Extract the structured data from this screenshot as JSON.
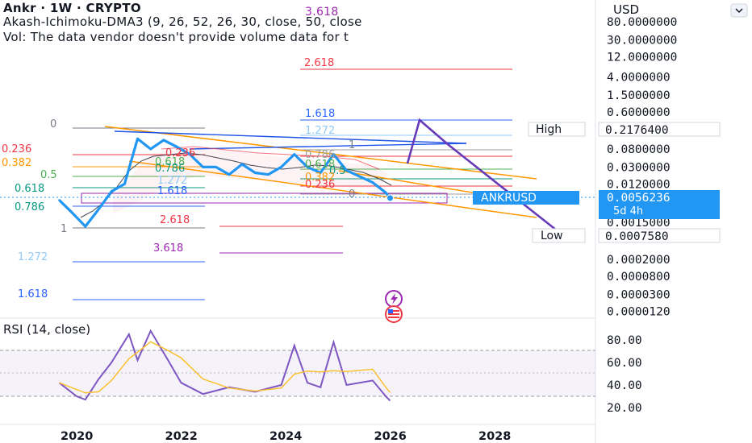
{
  "header": {
    "line1": "Ankr · 1W · CRYPTO",
    "line2": "Akash-Ichimoku-DMA3 (9, 26, 52, 26, 30, close, 50, close",
    "line3": "Vol: The data vendor doesn't provide volume data for t",
    "overlay_number": "3.618"
  },
  "currency": "USD",
  "collapse_icon": "chevron-collapse-icon",
  "price_axis": {
    "scale": "log",
    "ticks": [
      {
        "label": "80.0000000",
        "value": 80
      },
      {
        "label": "30.0000000",
        "value": 30
      },
      {
        "label": "12.0000000",
        "value": 12
      },
      {
        "label": "4.0000000",
        "value": 4
      },
      {
        "label": "1.5000000",
        "value": 1.5
      },
      {
        "label": "0.6000000",
        "value": 0.6
      },
      {
        "label": "0.0800000",
        "value": 0.08
      },
      {
        "label": "0.0300000",
        "value": 0.03
      },
      {
        "label": "0.0120000",
        "value": 0.012
      },
      {
        "label": "0.0015000",
        "value": 0.0015
      },
      {
        "label": "0.0002000",
        "value": 0.0002
      },
      {
        "label": "0.0000800",
        "value": 8e-05
      },
      {
        "label": "0.0000300",
        "value": 3e-05
      },
      {
        "label": "0.0000120",
        "value": 1.2e-05
      }
    ],
    "high": {
      "tag": "High",
      "value": "0.2176400"
    },
    "low": {
      "tag": "Low",
      "value": "0.0007580"
    },
    "last": {
      "symbol": "ANKRUSD",
      "value": "0.0056236",
      "countdown": "5d 4h"
    }
  },
  "time_axis": [
    "2020",
    "2022",
    "2024",
    "2026",
    "2028"
  ],
  "fib_labels": {
    "upper": [
      "3.618",
      "2.618",
      "1.618",
      "1.272",
      "1",
      "0.786",
      "0.618",
      "0.5",
      "0.382",
      "0.236",
      "0"
    ],
    "left": [
      "0",
      "0.236",
      "0.382",
      "0.5",
      "0.618",
      "0.786",
      "1",
      "1.272",
      "1.618"
    ],
    "inner": [
      "0.5",
      "1.272",
      "1.618",
      "2.618",
      "3.618",
      "0.618",
      "0.786",
      "0.382",
      "0.236"
    ]
  },
  "rsi": {
    "title": "RSI (14, close)",
    "ticks": [
      "80.00",
      "60.00",
      "40.00",
      "20.00"
    ]
  },
  "colors": {
    "price": "#2196f3",
    "channel": "#ff9800",
    "projection": "#673ab7",
    "fib_red": "#f23645",
    "fib_blue": "#2962ff",
    "rsi": "#7e57c2",
    "rsi_ma": "#fbc02d",
    "high_low_tag_bg": "#d1d4dc"
  },
  "chart_data": {
    "type": "line",
    "title": "Ankr · 1W · CRYPTO",
    "ylabel": "USD",
    "x_range": [
      "2019-06",
      "2028-06"
    ],
    "y_scale": "log",
    "series": [
      {
        "name": "ANKRUSD",
        "x": [
          "2019-09",
          "2019-12",
          "2020-03",
          "2020-06",
          "2020-09",
          "2020-12",
          "2021-03",
          "2021-06",
          "2021-09",
          "2021-12",
          "2022-03",
          "2022-06",
          "2022-09",
          "2022-12",
          "2023-03",
          "2023-06",
          "2023-09",
          "2023-12",
          "2024-03",
          "2024-06",
          "2024-09",
          "2024-12",
          "2025-03",
          "2025-06",
          "2025-09",
          "2025-12",
          "2026-01"
        ],
        "y": [
          0.005,
          0.0025,
          0.0012,
          0.003,
          0.008,
          0.012,
          0.14,
          0.08,
          0.13,
          0.09,
          0.06,
          0.03,
          0.03,
          0.02,
          0.035,
          0.022,
          0.02,
          0.03,
          0.06,
          0.03,
          0.022,
          0.06,
          0.025,
          0.018,
          0.013,
          0.0075,
          0.0056
        ]
      }
    ],
    "rsi": {
      "name": "RSI (14, close)",
      "ylim": [
        10,
        95
      ],
      "x": [
        "2019-09",
        "2020-01",
        "2020-03",
        "2020-06",
        "2020-09",
        "2021-01",
        "2021-03",
        "2021-06",
        "2021-10",
        "2022-01",
        "2022-06",
        "2022-12",
        "2023-06",
        "2023-12",
        "2024-03",
        "2024-06",
        "2024-09",
        "2024-12",
        "2025-03",
        "2025-09",
        "2025-12",
        "2026-01"
      ],
      "values": [
        42,
        30,
        27,
        45,
        60,
        85,
        62,
        88,
        62,
        42,
        32,
        38,
        34,
        40,
        75,
        42,
        38,
        78,
        40,
        44,
        30,
        26
      ]
    }
  }
}
